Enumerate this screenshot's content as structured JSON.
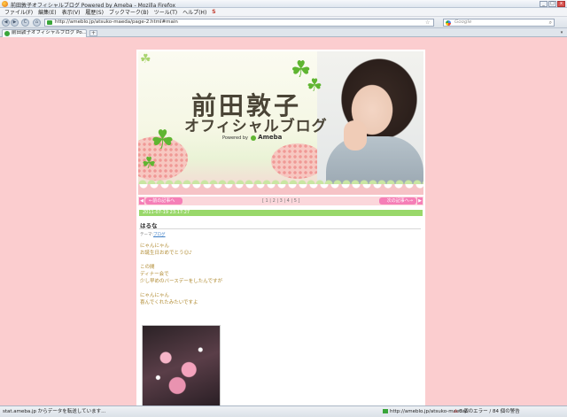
{
  "window": {
    "title": "前田敦子オフィシャルブログ Powered by Ameba - Mozilla Firefox",
    "min": "_",
    "max": "□",
    "close": "x"
  },
  "menu": {
    "items": [
      "ファイル(F)",
      "編集(E)",
      "表示(V)",
      "履歴(S)",
      "ブックマーク(B)",
      "ツール(T)",
      "ヘルプ(H)"
    ],
    "addon_icon": "S"
  },
  "nav": {
    "back": "◀",
    "forward": "▶",
    "reload": "C",
    "stop": "✕",
    "home": "⌂",
    "url": "http://ameblo.jp/atsuko-maeda/page-2.html#main",
    "star": "☆",
    "search_placeholder": "Google",
    "search_btn": "⌕"
  },
  "tabs": {
    "active_label": "前田敦子オフィシャルブログ Po...",
    "new_tab": "+",
    "list": "▾"
  },
  "blog": {
    "header_title": "前田敦子",
    "header_subtitle": "オフィシャルブログ",
    "powered_by": "Powered by",
    "ameba": "Ameba",
    "pager": {
      "prev_arrow": "◀",
      "prev": "←前の記事へ",
      "numbers": "[ 1 | 2 | 3 | 4 | 5 ]",
      "next": "次の記事へ→",
      "next_arrow": "▶"
    },
    "entry": {
      "date": "2011-07-19 23:17:27",
      "title": "はるな",
      "theme_prefix": "テーマ:",
      "theme": "ブログ",
      "lines": [
        "にゃんにゃん",
        "お誕生日おめでとう☺♪",
        "",
        "この間",
        "ディナー会で",
        "少し早めのバースデーをしたんですが",
        "",
        "にゃんにゃん",
        "喜んでくれたみたいですよ"
      ]
    }
  },
  "status": {
    "text": "stat.ameba.jp からデータを転送しています...",
    "url": "http://ameblo.jp/atsuko-maeda/",
    "errors": "0 個のエラー / 84 個の警告"
  },
  "colors": {
    "page_bg": "#fbcdcf",
    "date_bar": "#99d86a",
    "pager_btn": "#f57fb7",
    "body_text": "#b08a30"
  }
}
